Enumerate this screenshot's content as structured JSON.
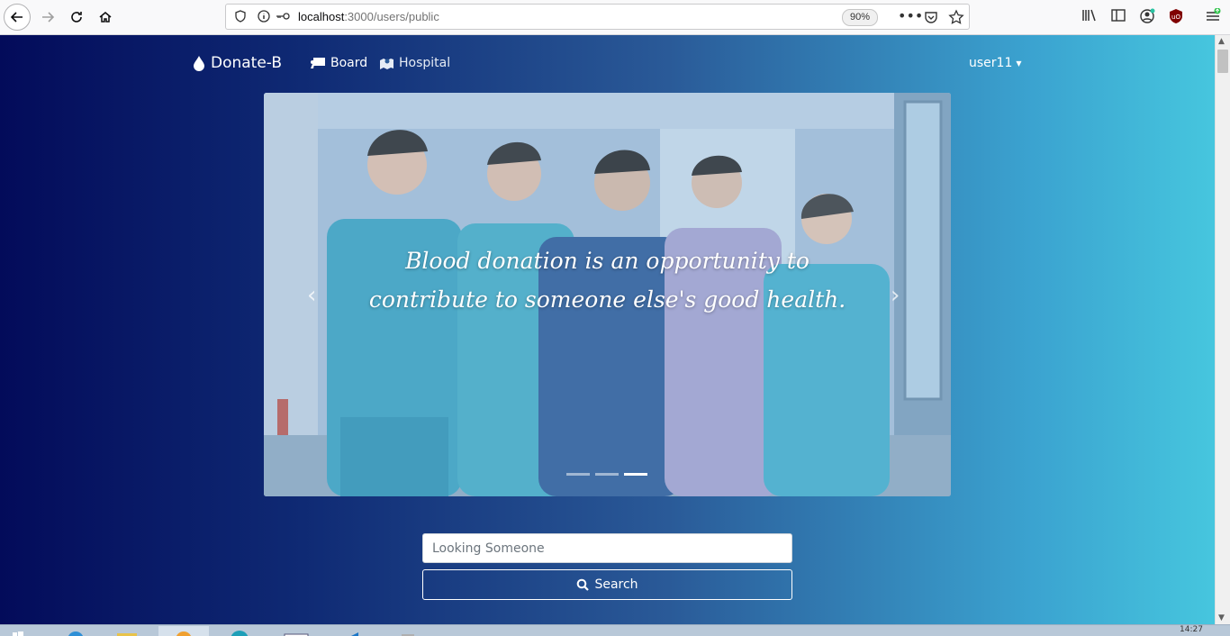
{
  "browser": {
    "url_host": "localhost",
    "url_path": ":3000/users/public",
    "zoom": "90%"
  },
  "navbar": {
    "brand": "Donate-B",
    "links": [
      {
        "label": "Board"
      },
      {
        "label": "Hospital"
      }
    ],
    "user": "user11"
  },
  "carousel": {
    "caption_line1": "Blood donation is an opportunity to",
    "caption_line2": "contribute to someone else's good health.",
    "slide_count": 3,
    "active_slide": 3
  },
  "search": {
    "placeholder": "Looking Someone",
    "value": "",
    "button_label": "Search"
  },
  "taskbar": {
    "clock": "14:27"
  },
  "colors": {
    "gradient_start": "#030b5a",
    "gradient_end": "#46c6de",
    "scrub_teal": "#3aa6c4",
    "scrub_navy": "#2c5c9a",
    "scrub_lavender": "#a9a6d4"
  }
}
